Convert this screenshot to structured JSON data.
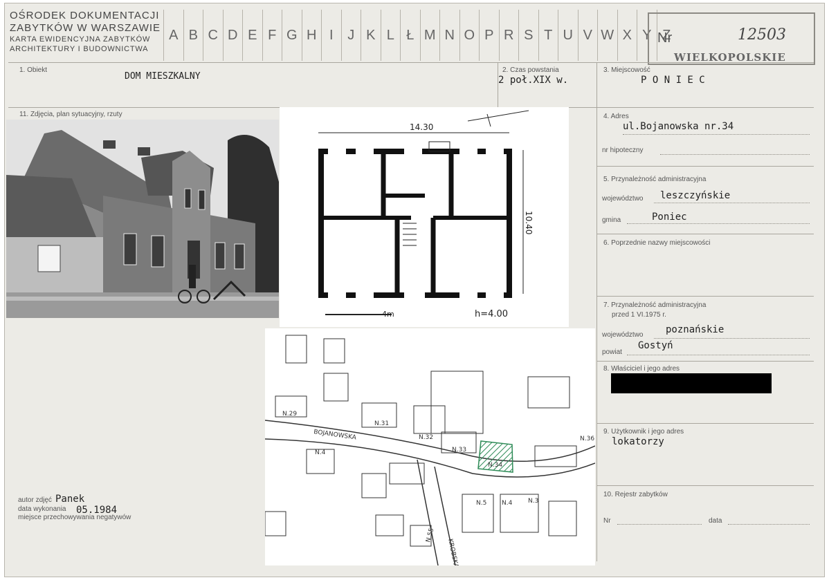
{
  "header": {
    "institution_line1": "OŚRODEK DOKUMENTACJI",
    "institution_line2": "ZABYTKÓW W WARSZAWIE",
    "institution_line3": "KARTA EWIDENCYJNA ZABYTKÓW",
    "institution_line4": "ARCHITEKTURY I BUDOWNICTWA",
    "alphabet": [
      "A",
      "B",
      "C",
      "D",
      "E",
      "F",
      "G",
      "H",
      "I",
      "J",
      "K",
      "L",
      "Ł",
      "M",
      "N",
      "O",
      "P",
      "R",
      "S",
      "T",
      "U",
      "V",
      "W",
      "X",
      "Y",
      "Z"
    ],
    "nr_label": "Nr",
    "nr_value": "12503",
    "stamp": "WIELKOPOLSKIE"
  },
  "fields": {
    "obiekt_label": "1. Obiekt",
    "obiekt_value": "DOM MIESZKALNY",
    "czas_label": "2. Czas powstania",
    "czas_value": "2 poł.XIX w.",
    "miejscowosc_label": "3. Miejscowość",
    "miejscowosc_value": "P O N I E C",
    "adres_label": "4. Adres",
    "adres_value": "ul.Bojanowska nr.34",
    "hipoteczny_label": "nr hipoteczny",
    "przynaleznosc_label": "5. Przynależność administracyjna",
    "wojewodztwo_label": "województwo",
    "wojewodztwo_value": "leszczyńskie",
    "gmina_label": "gmina",
    "gmina_value": "Poniec",
    "poprzednie_label": "6. Poprzednie nazwy miejscowości",
    "przed_label_1": "7. Przynależność administracyjna",
    "przed_label_2": "przed 1 VI.1975 r.",
    "woj_przed_label": "województwo",
    "woj_przed_value": "poznańskie",
    "powiat_label": "powiat",
    "powiat_value": "Gostyń",
    "wlasciciel_label": "8. Właściciel i jego adres",
    "uzytkownik_label": "9. Użytkownik i jego adres",
    "uzytkownik_value": "lokatorzy",
    "rejestr_label": "10. Rejestr zabytków",
    "rejestr_nr_label": "Nr",
    "rejestr_data_label": "data",
    "zdjecia_label": "11. Zdjęcia, plan sytuacyjny, rzuty",
    "autor_label": "autor zdjęć",
    "autor_value": "Panek",
    "data_label": "data wykonania",
    "data_value": "05.1984",
    "miejsce_label": "miejsce przechowywania negatywów"
  },
  "plan": {
    "width_dim": "14.30",
    "depth_dim": "10.40",
    "scale": "4m",
    "height": "h=4.00"
  },
  "map": {
    "labels": [
      "N.29",
      "N.31",
      "N.32",
      "N.33",
      "N.34",
      "N.36",
      "N.4",
      "N.5",
      "N.4",
      "N.3",
      "N.55"
    ],
    "street_1": "BOJANOWSKA",
    "street_2": "KROBSKA"
  },
  "colors": {
    "card": "#ecebe6",
    "ink": "#222222",
    "hatch": "#2e8b57"
  }
}
